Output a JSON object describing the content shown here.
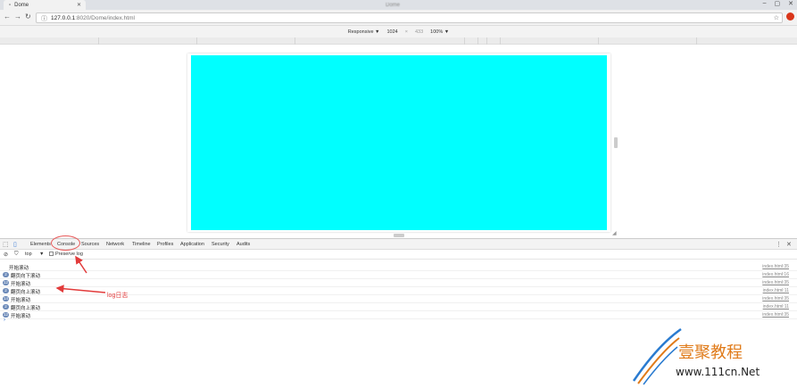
{
  "tabs": {
    "active_title": "Dome",
    "blurred": [
      "",
      "",
      "",
      "",
      "Dome"
    ]
  },
  "address": {
    "host": "127.0.0.1",
    "path": ":8020/Dome/index.html"
  },
  "emulation": {
    "device": "Responsive ▼",
    "width": "1024",
    "times": "×",
    "height": "433",
    "zoom": "100% ▼"
  },
  "devtools": {
    "tabs": [
      "Elements",
      "Console",
      "Sources",
      "Network",
      "Timeline",
      "Profiles",
      "Application",
      "Security",
      "Audits"
    ]
  },
  "console": {
    "context": "top",
    "context_arrow": "▼",
    "preserve_log": "Preserve log",
    "rows": [
      {
        "badge": "",
        "message": "开始滚动",
        "source": "index.html:35"
      },
      {
        "badge": "2",
        "message": "翻页向下滚动",
        "source": "index.html:16"
      },
      {
        "badge": "12",
        "message": "开始滚动",
        "source": "index.html:35"
      },
      {
        "badge": "2",
        "message": "翻页向上滚动",
        "source": "index.html:11"
      },
      {
        "badge": "14",
        "message": "开始滚动",
        "source": "index.html:35"
      },
      {
        "badge": "2",
        "message": "翻页向上滚动",
        "source": "index.html:11"
      },
      {
        "badge": "12",
        "message": "开始滚动",
        "source": "index.html:35"
      }
    ],
    "prompt": "›"
  },
  "annotation": {
    "text": "log日志",
    "color": "#e23b3b"
  },
  "watermark": {
    "logo": "壹聚教程",
    "url": "www.111cn.Net"
  },
  "colors": {
    "viewport": "#00ffff",
    "badge": "#6c8ab8"
  },
  "icons": [
    "page-icon",
    "back-icon",
    "forward-icon",
    "reload-icon",
    "info-icon",
    "star-icon",
    "extension-icon",
    "inspect-icon",
    "device-icon",
    "clear-icon",
    "filter-icon",
    "more-icon",
    "close-icon"
  ]
}
